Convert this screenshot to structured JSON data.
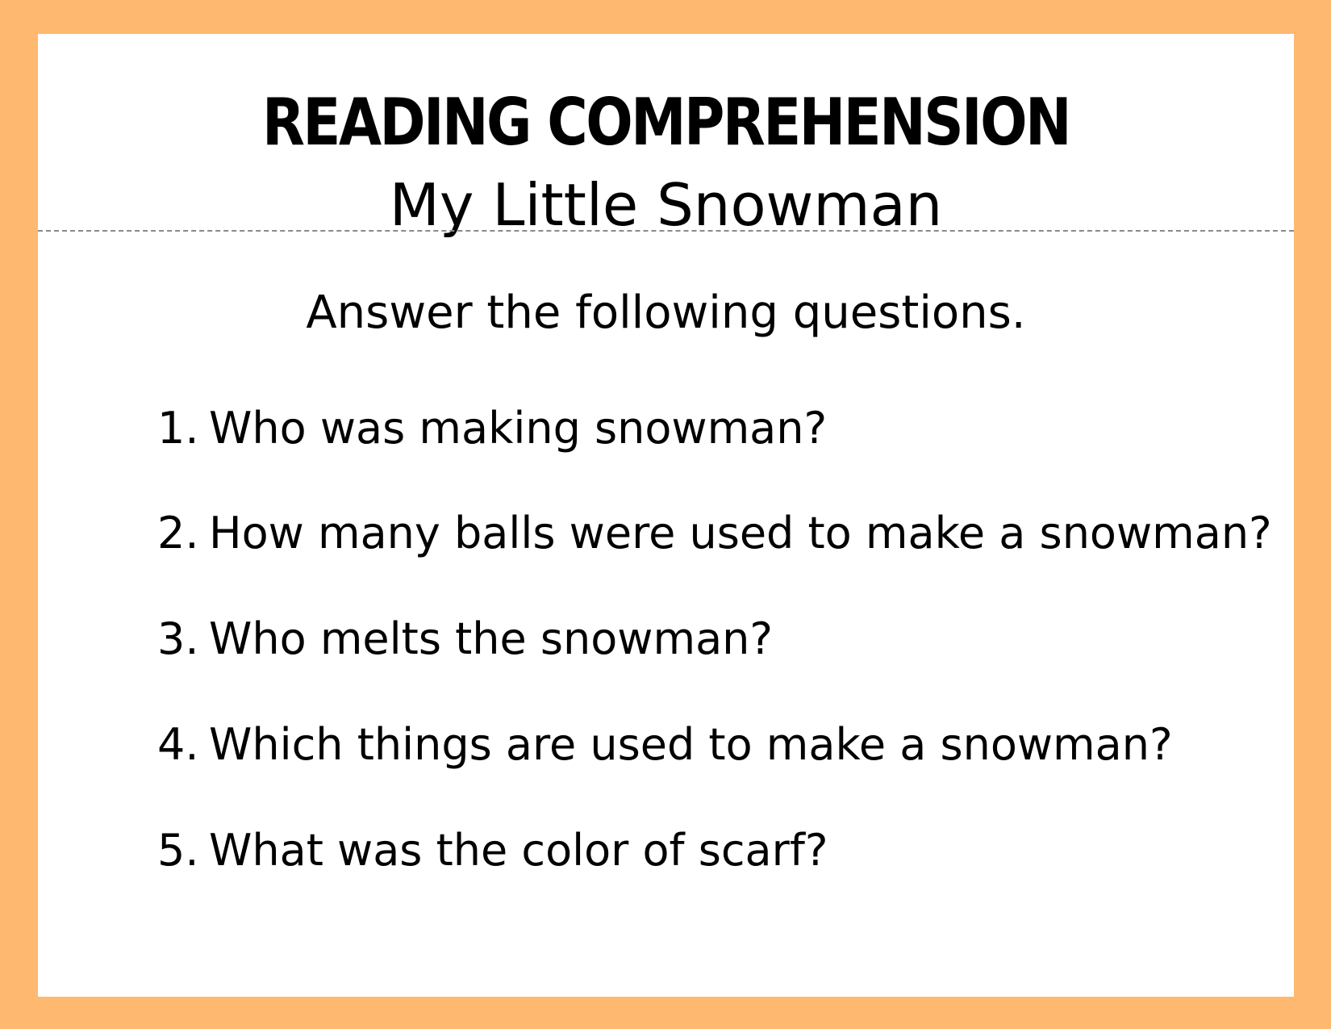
{
  "worksheet": {
    "title": "READING COMPREHENSION",
    "subtitle": "My Little Snowman",
    "instruction": "Answer the following questions.",
    "questions": [
      {
        "number": "1.",
        "text": "Who was making snowman?"
      },
      {
        "number": "2.",
        "text": "How many balls were used to make a snowman?"
      },
      {
        "number": "3.",
        "text": "Who melts the snowman?"
      },
      {
        "number": "4.",
        "text": "Which things are used to make a snowman?"
      },
      {
        "number": "5.",
        "text": "What was the color of scarf?"
      }
    ]
  },
  "colors": {
    "border": "#FFB870",
    "sheet": "#FFFFFF",
    "text": "#000000",
    "divider": "#8A8A8A"
  }
}
